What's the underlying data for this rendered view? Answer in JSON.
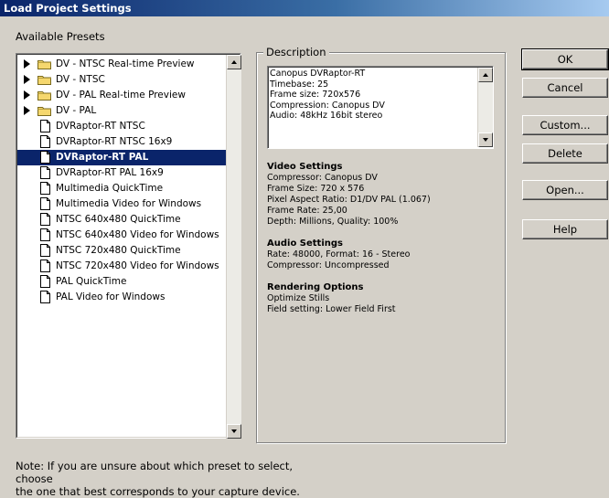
{
  "window": {
    "title": "Load Project Settings"
  },
  "presets": {
    "label": "Available Presets",
    "items": [
      {
        "label": "DV - NTSC Real-time Preview",
        "kind": "folder"
      },
      {
        "label": "DV - NTSC",
        "kind": "folder"
      },
      {
        "label": "DV - PAL Real-time Preview",
        "kind": "folder"
      },
      {
        "label": "DV - PAL",
        "kind": "folder"
      },
      {
        "label": "DVRaptor-RT NTSC",
        "kind": "file"
      },
      {
        "label": "DVRaptor-RT NTSC 16x9",
        "kind": "file"
      },
      {
        "label": "DVRaptor-RT PAL",
        "kind": "file",
        "selected": true
      },
      {
        "label": "DVRaptor-RT PAL 16x9",
        "kind": "file"
      },
      {
        "label": "Multimedia QuickTime",
        "kind": "file"
      },
      {
        "label": "Multimedia Video for Windows",
        "kind": "file"
      },
      {
        "label": "NTSC 640x480 QuickTime",
        "kind": "file"
      },
      {
        "label": "NTSC 640x480 Video for Windows",
        "kind": "file"
      },
      {
        "label": "NTSC 720x480 QuickTime",
        "kind": "file"
      },
      {
        "label": "NTSC 720x480 Video for Windows",
        "kind": "file"
      },
      {
        "label": "PAL QuickTime",
        "kind": "file"
      },
      {
        "label": "PAL Video for Windows",
        "kind": "file"
      }
    ]
  },
  "description": {
    "title": "Description",
    "lines": [
      "Canopus DVRaptor-RT",
      "Timebase: 25",
      "Frame size: 720x576",
      "Compression: Canopus DV",
      "Audio: 48kHz 16bit stereo"
    ],
    "video": {
      "heading": "Video Settings",
      "lines": [
        "Compressor: Canopus DV",
        "Frame Size: 720 x 576",
        "Pixel Aspect Ratio: D1/DV PAL (1.067)",
        "Frame Rate: 25,00",
        "Depth: Millions, Quality: 100%"
      ]
    },
    "audio": {
      "heading": "Audio Settings",
      "lines": [
        "Rate: 48000, Format: 16 - Stereo",
        "Compressor: Uncompressed"
      ]
    },
    "rendering": {
      "heading": "Rendering Options",
      "lines": [
        "Optimize Stills",
        "Field setting: Lower Field First"
      ]
    }
  },
  "buttons": {
    "ok": "OK",
    "cancel": "Cancel",
    "custom": "Custom...",
    "delete": "Delete",
    "open": "Open...",
    "help": "Help"
  },
  "note": {
    "line1": "Note: If you are unsure about which preset to select, choose",
    "line2": "the one that best corresponds to your capture device."
  }
}
